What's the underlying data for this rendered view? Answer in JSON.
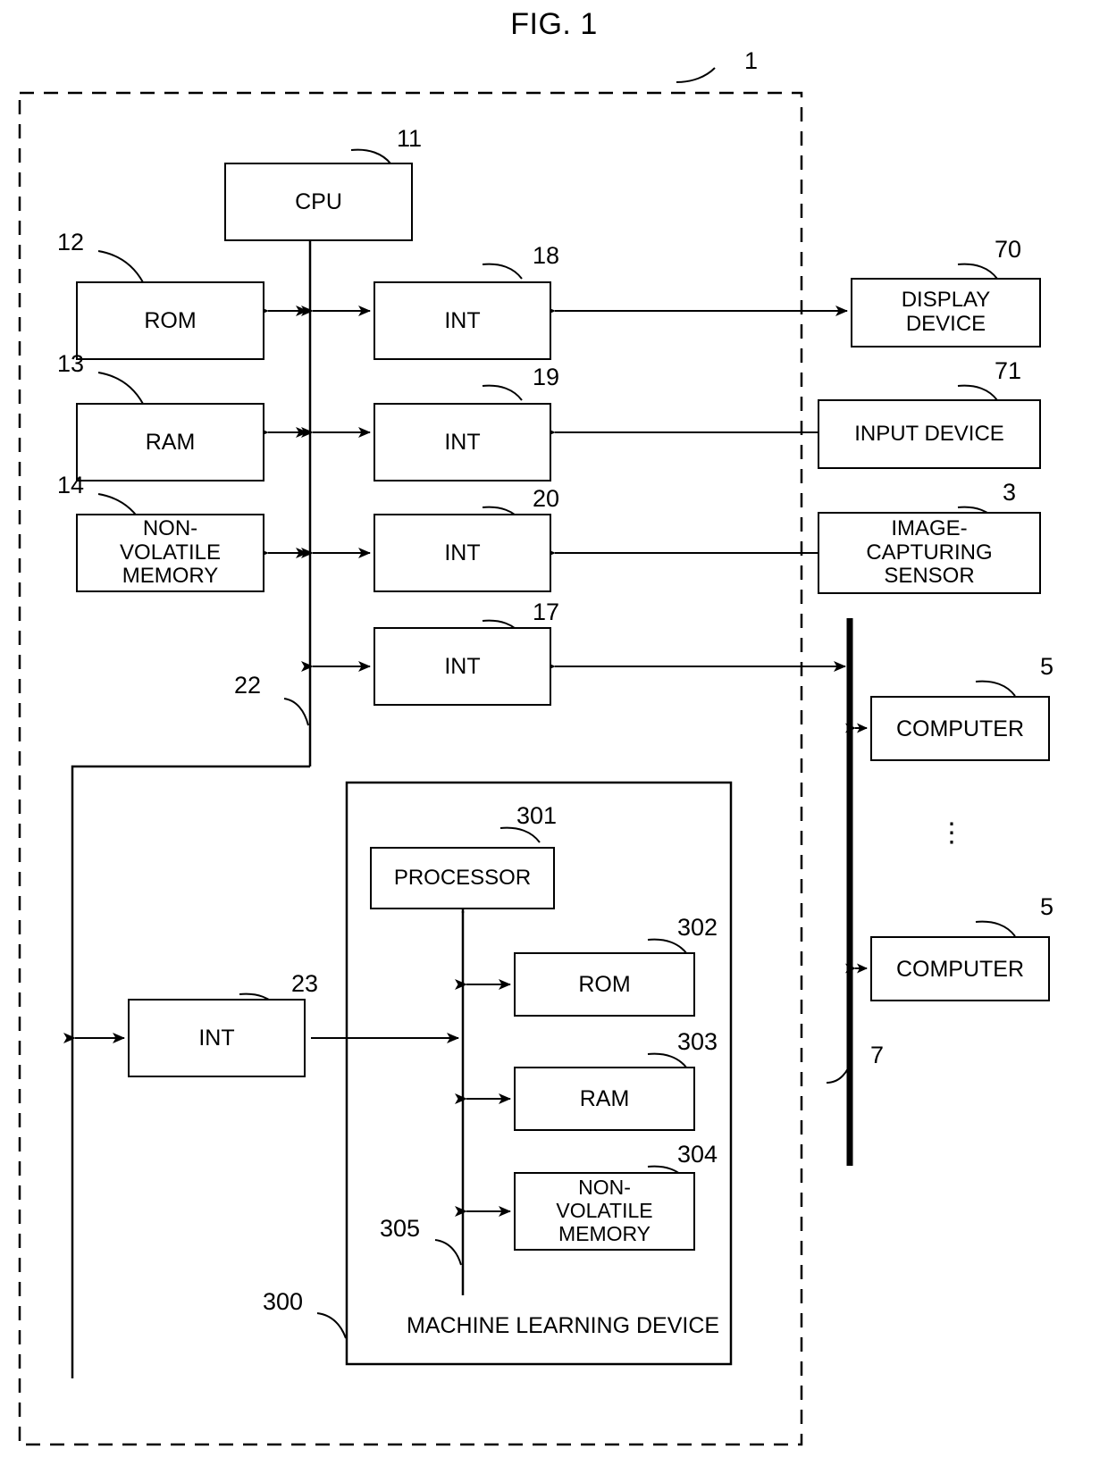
{
  "figure": {
    "title": "FIG. 1",
    "outer_ref": "1"
  },
  "nodes": [
    {
      "id": "cpu",
      "label": "CPU",
      "ref": "11"
    },
    {
      "id": "rom12",
      "label": "ROM",
      "ref": "12"
    },
    {
      "id": "ram13",
      "label": "RAM",
      "ref": "13"
    },
    {
      "id": "nvm14",
      "label": "NON-\nVOLATILE\nMEMORY",
      "ref": "14"
    },
    {
      "id": "int18",
      "label": "INT",
      "ref": "18"
    },
    {
      "id": "int19",
      "label": "INT",
      "ref": "19"
    },
    {
      "id": "int20",
      "label": "INT",
      "ref": "20"
    },
    {
      "id": "int17",
      "label": "INT",
      "ref": "17"
    },
    {
      "id": "int23",
      "label": "INT",
      "ref": "23"
    },
    {
      "id": "display70",
      "label": "DISPLAY\nDEVICE",
      "ref": "70"
    },
    {
      "id": "input71",
      "label": "INPUT DEVICE",
      "ref": "71"
    },
    {
      "id": "sensor3",
      "label": "IMAGE-\nCAPTURING\nSENSOR",
      "ref": "3"
    },
    {
      "id": "computer5a",
      "label": "COMPUTER",
      "ref": "5"
    },
    {
      "id": "computer5b",
      "label": "COMPUTER",
      "ref": "5"
    },
    {
      "id": "processor301",
      "label": "PROCESSOR",
      "ref": "301"
    },
    {
      "id": "rom302",
      "label": "ROM",
      "ref": "302"
    },
    {
      "id": "ram303",
      "label": "RAM",
      "ref": "303"
    },
    {
      "id": "nvm304",
      "label": "NON-\nVOLATILE\nMEMORY",
      "ref": "304"
    }
  ],
  "containers": [
    {
      "id": "ml_device",
      "label": "MACHINE LEARNING DEVICE",
      "ref": "300"
    }
  ],
  "bus_refs": [
    {
      "id": "bus22",
      "ref": "22"
    },
    {
      "id": "bus305",
      "ref": "305"
    },
    {
      "id": "bus7",
      "ref": "7"
    }
  ],
  "ellipsis": "⋮",
  "colors": {
    "stroke": "#000000",
    "background": "#ffffff"
  }
}
